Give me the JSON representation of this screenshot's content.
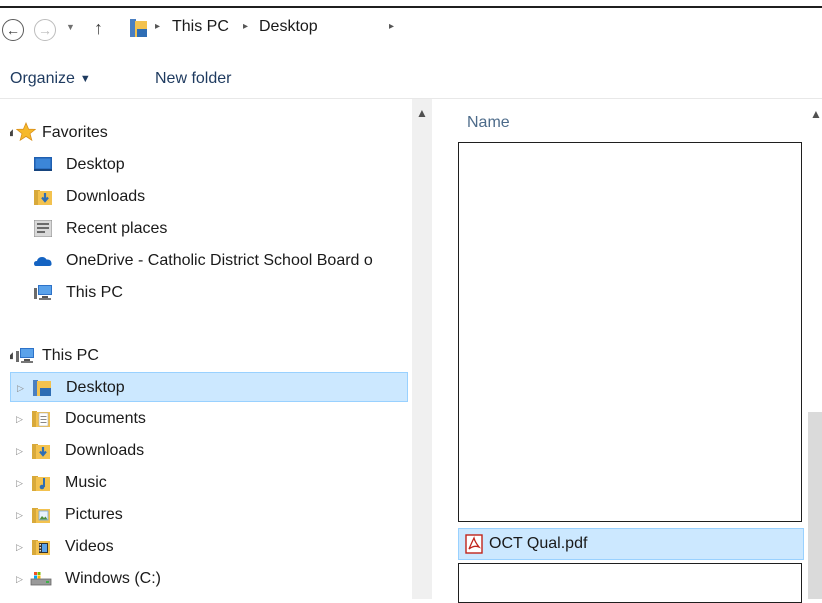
{
  "address_bar": {
    "breadcrumbs": [
      "This PC",
      "Desktop"
    ],
    "back_icon": "arrow-left-icon",
    "forward_icon": "arrow-right-icon",
    "recent_icon": "chevron-down-icon",
    "up_icon": "arrow-up-icon",
    "separator": "▸"
  },
  "toolbar": {
    "organize_label": "Organize",
    "new_folder_label": "New folder"
  },
  "nav": {
    "favorites": {
      "label": "Favorites",
      "items": [
        {
          "label": "Desktop",
          "icon": "desktop-icon"
        },
        {
          "label": "Downloads",
          "icon": "downloads-folder-icon"
        },
        {
          "label": "Recent places",
          "icon": "recent-places-icon"
        },
        {
          "label": "OneDrive - Catholic District School Board o",
          "icon": "onedrive-icon"
        },
        {
          "label": "This PC",
          "icon": "computer-icon"
        }
      ]
    },
    "this_pc": {
      "label": "This PC",
      "items": [
        {
          "label": "Desktop",
          "icon": "desktop-folder-icon",
          "selected": true
        },
        {
          "label": "Documents",
          "icon": "documents-folder-icon"
        },
        {
          "label": "Downloads",
          "icon": "downloads-folder-icon"
        },
        {
          "label": "Music",
          "icon": "music-folder-icon"
        },
        {
          "label": "Pictures",
          "icon": "pictures-folder-icon"
        },
        {
          "label": "Videos",
          "icon": "videos-folder-icon"
        },
        {
          "label": "Windows (C:)",
          "icon": "drive-icon"
        }
      ]
    }
  },
  "file_list": {
    "column_name": "Name",
    "files": [
      {
        "name": "OCT Qual.pdf",
        "icon": "pdf-icon",
        "selected": true
      }
    ]
  },
  "colors": {
    "selection_bg": "#cce8ff",
    "selection_border": "#99d1ff",
    "toolbar_text": "#1e3a5f"
  }
}
